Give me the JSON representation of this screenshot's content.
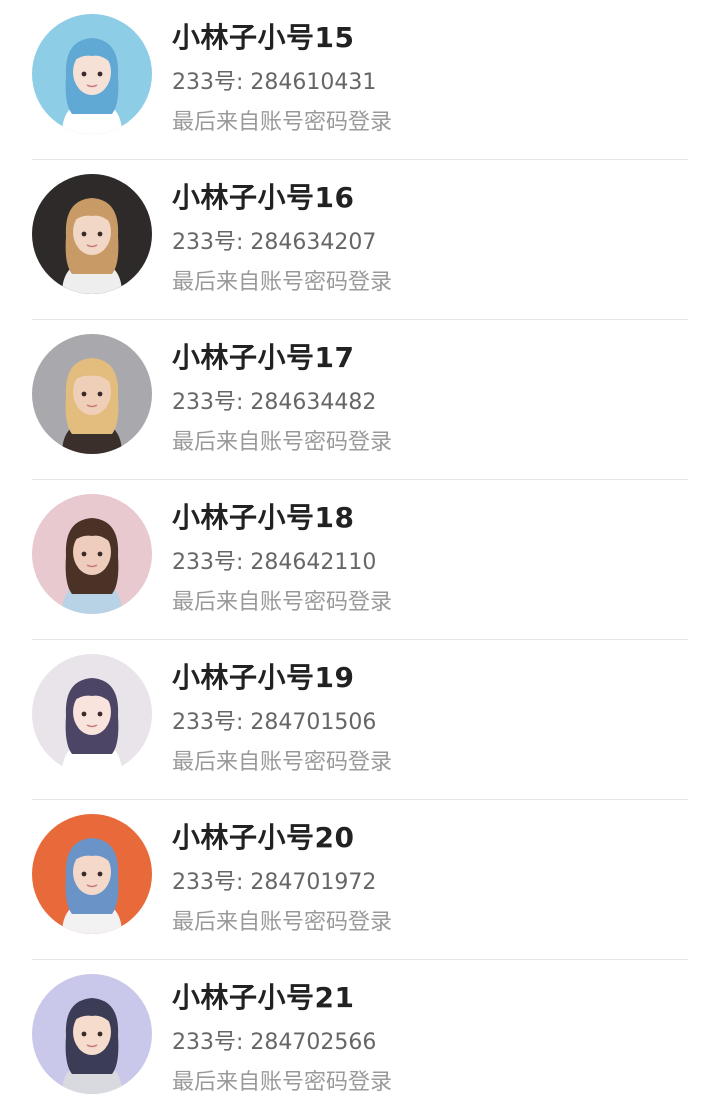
{
  "accounts": [
    {
      "name": "小林子小号15",
      "uid_prefix": "233号: ",
      "uid": "284610431",
      "login_source": "最后来自账号密码登录",
      "avatar": {
        "icon": "avatar-anime-girl-blue-hair-icon",
        "bg": "#8ecde6",
        "hair": "#5fa9d4",
        "skin": "#f5e1d6",
        "cloth": "#ffffff"
      }
    },
    {
      "name": "小林子小号16",
      "uid_prefix": "233号: ",
      "uid": "284634207",
      "login_source": "最后来自账号密码登录",
      "avatar": {
        "icon": "avatar-boy-crown-icon",
        "bg": "#2e2a2a",
        "hair": "#c89a66",
        "skin": "#f1d7c5",
        "cloth": "#eeeeee"
      }
    },
    {
      "name": "小林子小号17",
      "uid_prefix": "233号: ",
      "uid": "284634482",
      "login_source": "最后来自账号密码登录",
      "avatar": {
        "icon": "avatar-girl-blonde-sitting-icon",
        "bg": "#a9a9ad",
        "hair": "#e2bd7e",
        "skin": "#f0cfb8",
        "cloth": "#3b2f2c"
      }
    },
    {
      "name": "小林子小号18",
      "uid_prefix": "233号: ",
      "uid": "284642110",
      "login_source": "最后来自账号密码登录",
      "avatar": {
        "icon": "avatar-girl-curly-hair-icon",
        "bg": "#e8c9cf",
        "hair": "#4a3326",
        "skin": "#efcdbd",
        "cloth": "#b9d3e6"
      }
    },
    {
      "name": "小林子小号19",
      "uid_prefix": "233号: ",
      "uid": "284701506",
      "login_source": "最后来自账号密码登录",
      "avatar": {
        "icon": "avatar-anime-girl-purple-hair-icon",
        "bg": "#e9e3ea",
        "hair": "#4c4566",
        "skin": "#f8e4dc",
        "cloth": "#ffffff"
      }
    },
    {
      "name": "小林子小号20",
      "uid_prefix": "233号: ",
      "uid": "284701972",
      "login_source": "最后来自账号密码登录",
      "avatar": {
        "icon": "avatar-boy-blue-hair-icon",
        "bg": "#e86a3a",
        "hair": "#6a94c8",
        "skin": "#f4d9cb",
        "cloth": "#f2f2f2"
      }
    },
    {
      "name": "小林子小号21",
      "uid_prefix": "233号: ",
      "uid": "284702566",
      "login_source": "最后来自账号密码登录",
      "avatar": {
        "icon": "avatar-anime-boy-microphone-icon",
        "bg": "#c9c8ea",
        "hair": "#3b3c55",
        "skin": "#f5dccd",
        "cloth": "#d9d9e0"
      }
    }
  ]
}
